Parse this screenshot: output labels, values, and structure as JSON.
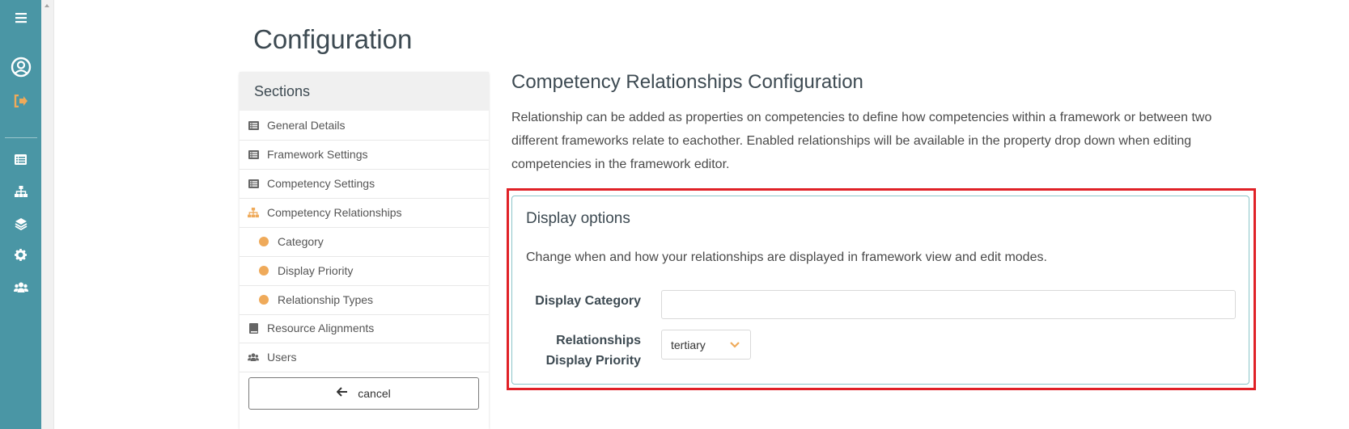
{
  "page": {
    "title": "Configuration"
  },
  "sidebar": {
    "icons": [
      "menu-icon",
      "user-circle-icon",
      "sign-out-icon",
      "list-icon",
      "sitemap-icon",
      "layers-icon",
      "gear-icon",
      "users-icon"
    ]
  },
  "sections": {
    "header": "Sections",
    "items": [
      {
        "label": "General Details",
        "icon": "list-icon"
      },
      {
        "label": "Framework Settings",
        "icon": "list-icon"
      },
      {
        "label": "Competency Settings",
        "icon": "list-icon"
      },
      {
        "label": "Competency Relationships",
        "icon": "sitemap-icon"
      },
      {
        "label": "Category",
        "icon": "dot-icon"
      },
      {
        "label": "Display Priority",
        "icon": "dot-icon"
      },
      {
        "label": "Relationship Types",
        "icon": "dot-icon"
      },
      {
        "label": "Resource Alignments",
        "icon": "book-icon"
      },
      {
        "label": "Users",
        "icon": "users-icon"
      }
    ],
    "cancel_label": "cancel"
  },
  "main": {
    "heading": "Competency Relationships Configuration",
    "description": "Relationship can be added as properties on competencies to define how competencies within a framework or between two different frameworks relate to eachother. Enabled relationships will be available in the property drop down when editing competencies in the framework editor."
  },
  "display_options": {
    "title": "Display options",
    "description": "Change when and how your relationships are displayed in framework view and edit modes.",
    "category_label": "Display Category",
    "category_value": "",
    "priority_label_line1": "Relationships",
    "priority_label_line2": "Display Priority",
    "priority_value": "tertiary"
  },
  "colors": {
    "sidebar": "#4a96a5",
    "accent_orange": "#efaa5a",
    "highlight_red": "#e02127",
    "card_border": "#8cc5c9"
  }
}
